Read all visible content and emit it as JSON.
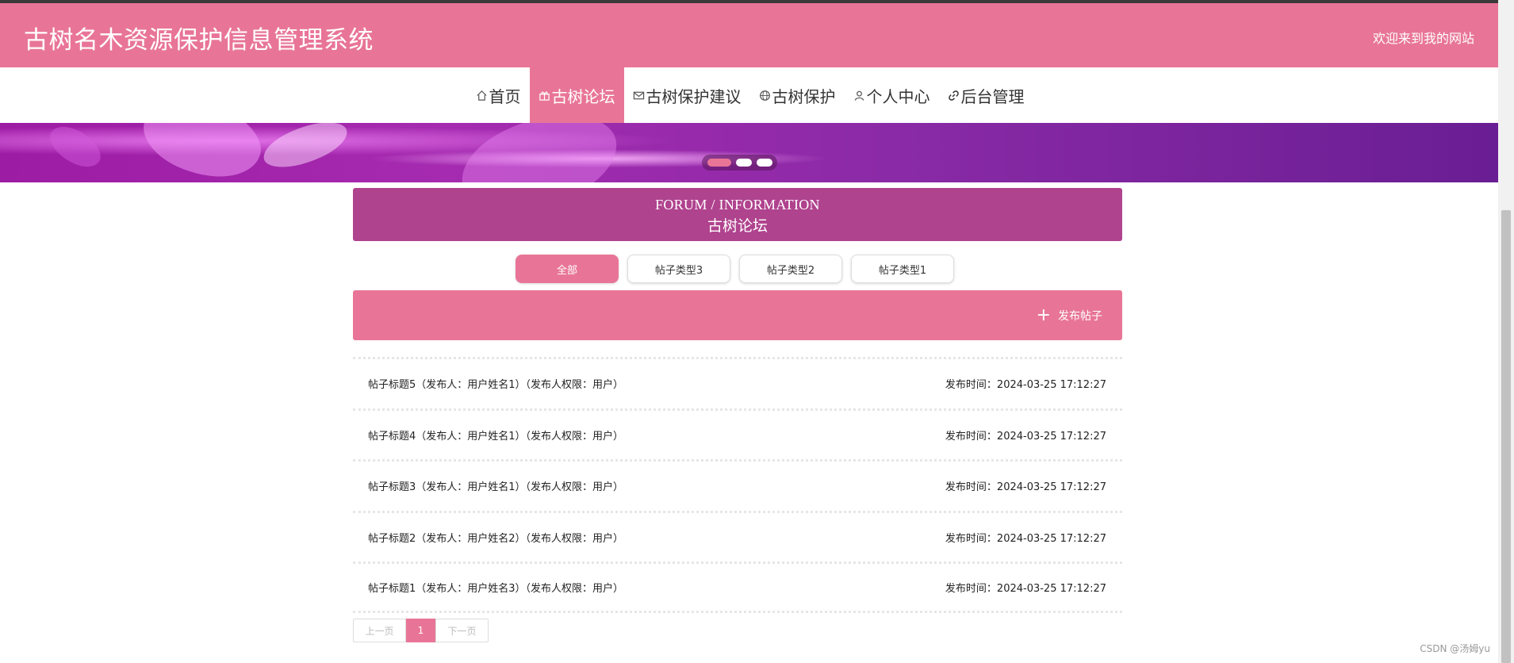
{
  "header": {
    "title": "古树名木资源保护信息管理系统",
    "welcome": "欢迎来到我的网站",
    "color": "#e87597"
  },
  "nav": {
    "items": [
      {
        "label": "首页",
        "icon": "home-icon"
      },
      {
        "label": "古树论坛",
        "icon": "gift-icon",
        "active": true
      },
      {
        "label": "古树保护建议",
        "icon": "mail-icon"
      },
      {
        "label": "古树保护",
        "icon": "globe-icon"
      },
      {
        "label": "个人中心",
        "icon": "user-icon"
      },
      {
        "label": "后台管理",
        "icon": "link-icon"
      }
    ]
  },
  "banner": {
    "slides": 3,
    "active_slide": 1
  },
  "forum": {
    "title_en": "FORUM / INFORMATION",
    "title_cn": "古树论坛",
    "color": "#b0438e"
  },
  "type_tabs": [
    {
      "label": "全部",
      "active": true
    },
    {
      "label": "帖子类型3"
    },
    {
      "label": "帖子类型2"
    },
    {
      "label": "帖子类型1"
    }
  ],
  "publish": {
    "label": "发布帖子",
    "icon": "plus-icon"
  },
  "posts": [
    {
      "title": "帖子标题5（发布人：用户姓名1）（发布人权限：用户）",
      "time": "发布时间：2024-03-25 17:12:27"
    },
    {
      "title": "帖子标题4（发布人：用户姓名1）（发布人权限：用户）",
      "time": "发布时间：2024-03-25 17:12:27"
    },
    {
      "title": "帖子标题3（发布人：用户姓名1）（发布人权限：用户）",
      "time": "发布时间：2024-03-25 17:12:27"
    },
    {
      "title": "帖子标题2（发布人：用户姓名2）（发布人权限：用户）",
      "time": "发布时间：2024-03-25 17:12:27"
    },
    {
      "title": "帖子标题1（发布人：用户姓名3）（发布人权限：用户）",
      "time": "发布时间：2024-03-25 17:12:27"
    }
  ],
  "pager": {
    "prev": "上一页",
    "current": "1",
    "next": "下一页"
  },
  "watermark": "CSDN @汤姆yu"
}
